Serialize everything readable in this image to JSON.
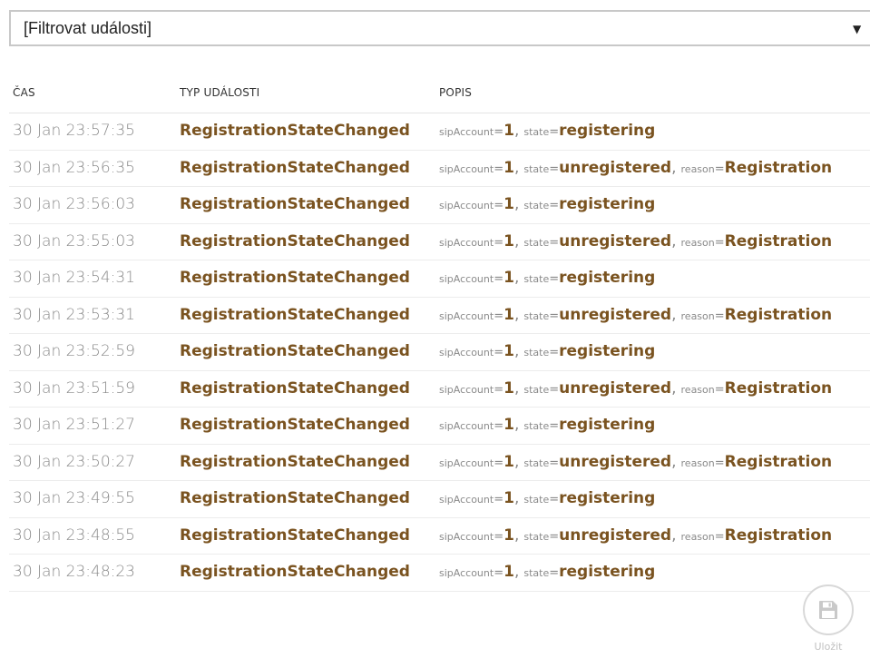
{
  "filter": {
    "selected": "[Filtrovat události]",
    "arrow_icon": "triangle-down-icon"
  },
  "table": {
    "columns": [
      "ČAS",
      "TYP UDÁLOSTI",
      "POPIS"
    ],
    "rows": [
      {
        "time": "30 Jan 23:57:35",
        "type": "RegistrationStateChanged",
        "sipAccount": "1",
        "state": "registering",
        "reason": ""
      },
      {
        "time": "30 Jan 23:56:35",
        "type": "RegistrationStateChanged",
        "sipAccount": "1",
        "state": "unregistered",
        "reason": "Registration"
      },
      {
        "time": "30 Jan 23:56:03",
        "type": "RegistrationStateChanged",
        "sipAccount": "1",
        "state": "registering",
        "reason": ""
      },
      {
        "time": "30 Jan 23:55:03",
        "type": "RegistrationStateChanged",
        "sipAccount": "1",
        "state": "unregistered",
        "reason": "Registration"
      },
      {
        "time": "30 Jan 23:54:31",
        "type": "RegistrationStateChanged",
        "sipAccount": "1",
        "state": "registering",
        "reason": ""
      },
      {
        "time": "30 Jan 23:53:31",
        "type": "RegistrationStateChanged",
        "sipAccount": "1",
        "state": "unregistered",
        "reason": "Registration"
      },
      {
        "time": "30 Jan 23:52:59",
        "type": "RegistrationStateChanged",
        "sipAccount": "1",
        "state": "registering",
        "reason": ""
      },
      {
        "time": "30 Jan 23:51:59",
        "type": "RegistrationStateChanged",
        "sipAccount": "1",
        "state": "unregistered",
        "reason": "Registration"
      },
      {
        "time": "30 Jan 23:51:27",
        "type": "RegistrationStateChanged",
        "sipAccount": "1",
        "state": "registering",
        "reason": ""
      },
      {
        "time": "30 Jan 23:50:27",
        "type": "RegistrationStateChanged",
        "sipAccount": "1",
        "state": "unregistered",
        "reason": "Registration"
      },
      {
        "time": "30 Jan 23:49:55",
        "type": "RegistrationStateChanged",
        "sipAccount": "1",
        "state": "registering",
        "reason": ""
      },
      {
        "time": "30 Jan 23:48:55",
        "type": "RegistrationStateChanged",
        "sipAccount": "1",
        "state": "unregistered",
        "reason": "Registration"
      },
      {
        "time": "30 Jan 23:48:23",
        "type": "RegistrationStateChanged",
        "sipAccount": "1",
        "state": "registering",
        "reason": ""
      }
    ],
    "desc_keys": {
      "sipAccount": "sipAccount",
      "state": "state",
      "reason": "reason"
    }
  },
  "save": {
    "label": "Uložit",
    "icon": "floppy-disk-icon"
  },
  "colors": {
    "accent_brown": "#7a5320",
    "muted_gray": "#8a8a8a",
    "border": "#c8c8c8"
  }
}
